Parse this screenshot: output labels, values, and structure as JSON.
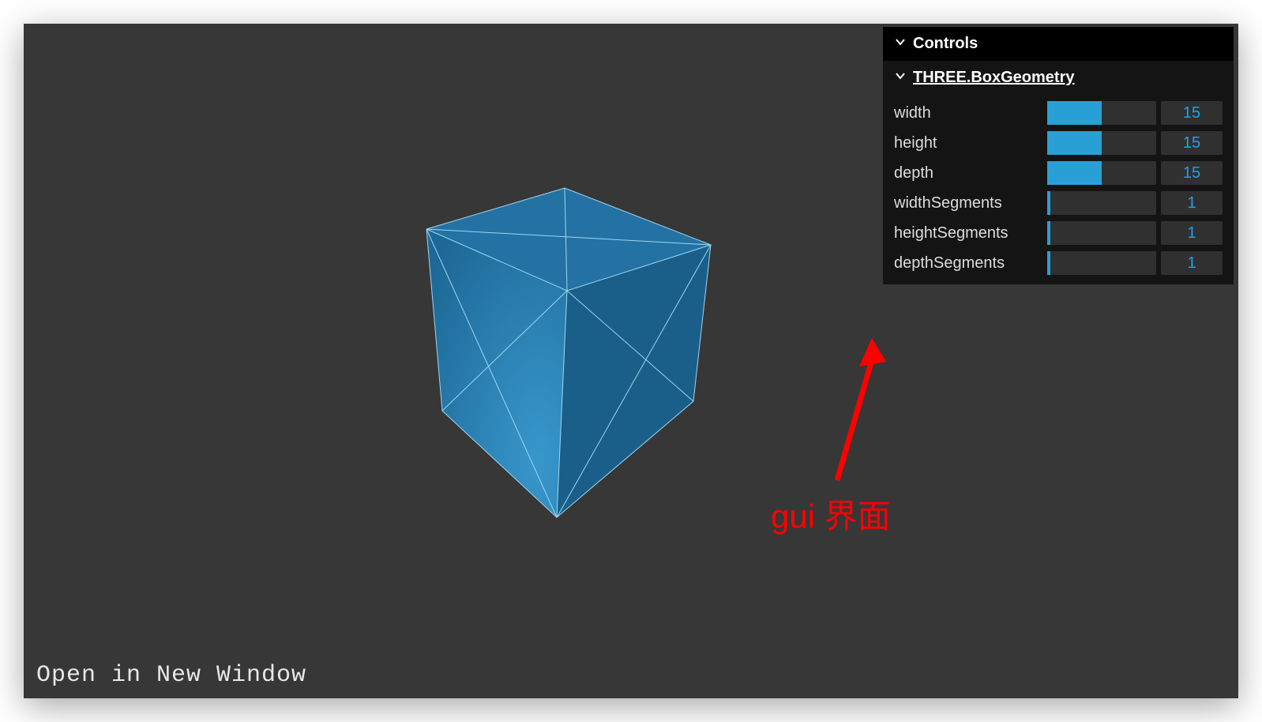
{
  "link_text": "Open in New Window",
  "annotation": "gui 界面",
  "panel": {
    "folder_title": "Controls",
    "subfolder_title": "THREE.BoxGeometry",
    "controls": [
      {
        "label": "width",
        "value": 15,
        "min": 0,
        "max": 30
      },
      {
        "label": "height",
        "value": 15,
        "min": 0,
        "max": 30
      },
      {
        "label": "depth",
        "value": 15,
        "min": 0,
        "max": 30
      },
      {
        "label": "widthSegments",
        "value": 1,
        "min": 1,
        "max": 30
      },
      {
        "label": "heightSegments",
        "value": 1,
        "min": 1,
        "max": 30
      },
      {
        "label": "depthSegments",
        "value": 1,
        "min": 1,
        "max": 30
      }
    ]
  },
  "cube": {
    "faces": {
      "top": "#2472a4",
      "left": "#1d6896",
      "right": "#1a5f89"
    },
    "wire": "#9fd6ef"
  }
}
